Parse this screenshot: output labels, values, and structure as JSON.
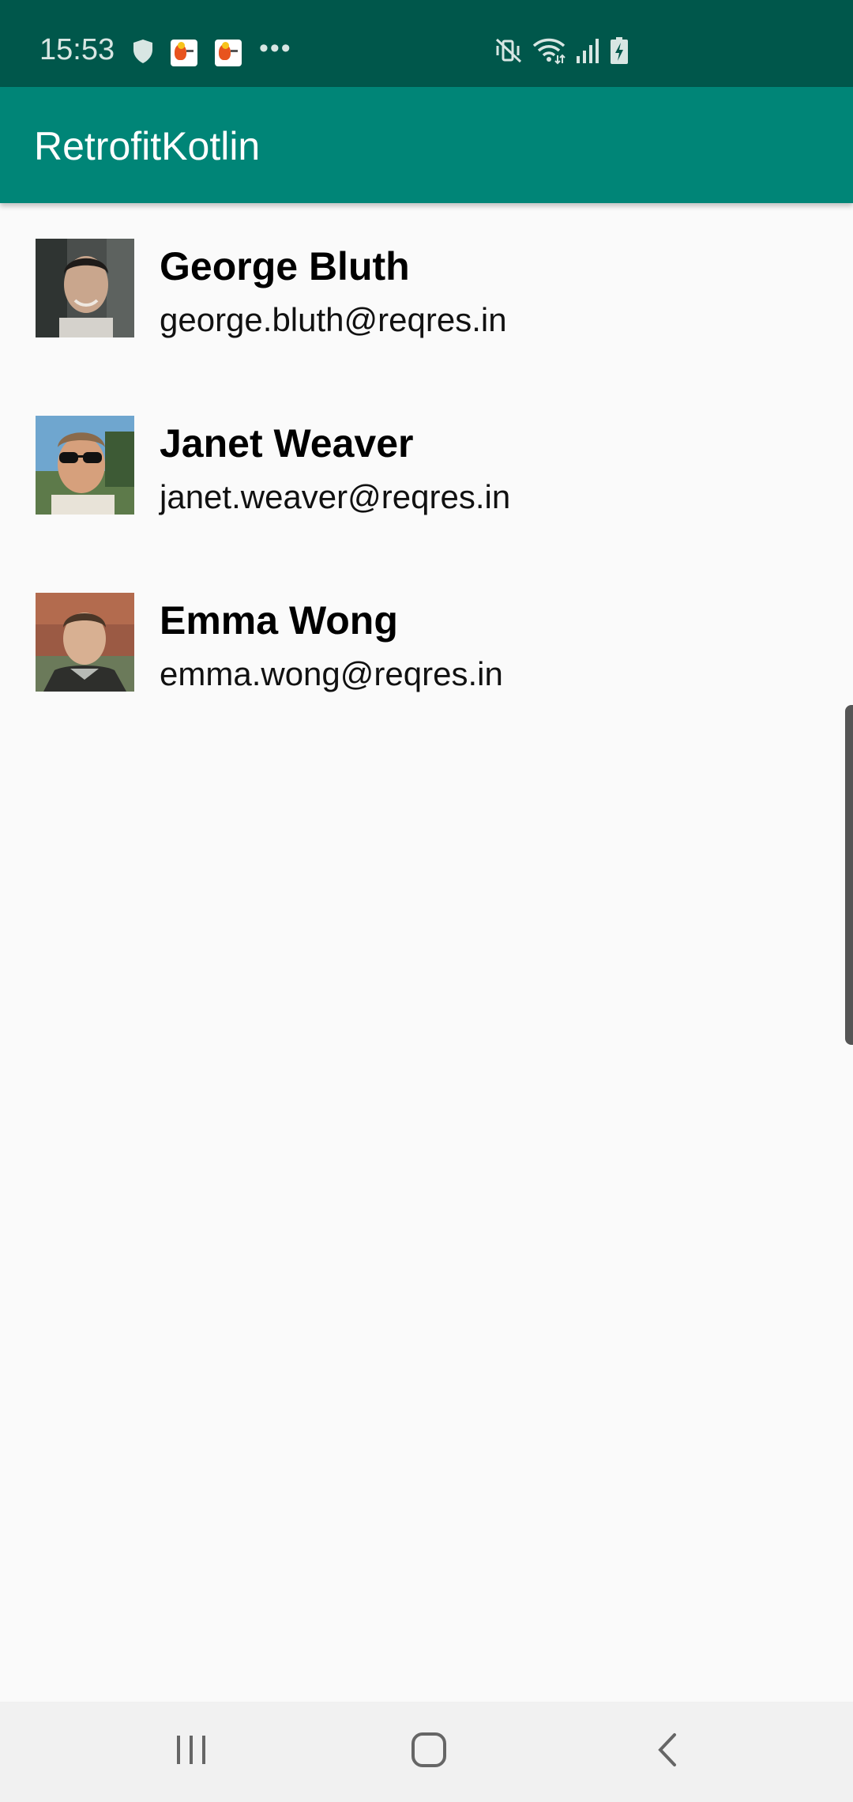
{
  "status_bar": {
    "time": "15:53",
    "left_icons": [
      "shield-icon",
      "app-notification-icon",
      "app-notification-icon",
      "more-dots-icon"
    ],
    "right_icons": [
      "vibrate-mute-icon",
      "wifi-icon",
      "signal-icon",
      "battery-charging-icon"
    ],
    "more_dots": "•••"
  },
  "app_bar": {
    "title": "RetrofitKotlin",
    "color": "#008577",
    "status_color": "#00574b"
  },
  "users": [
    {
      "name": "George Bluth",
      "email": "george.bluth@reqres.in"
    },
    {
      "name": "Janet Weaver",
      "email": "janet.weaver@reqres.in"
    },
    {
      "name": "Emma Wong",
      "email": "emma.wong@reqres.in"
    }
  ],
  "nav_bar": {
    "buttons": [
      "recent-apps-icon",
      "home-icon",
      "back-icon"
    ]
  }
}
